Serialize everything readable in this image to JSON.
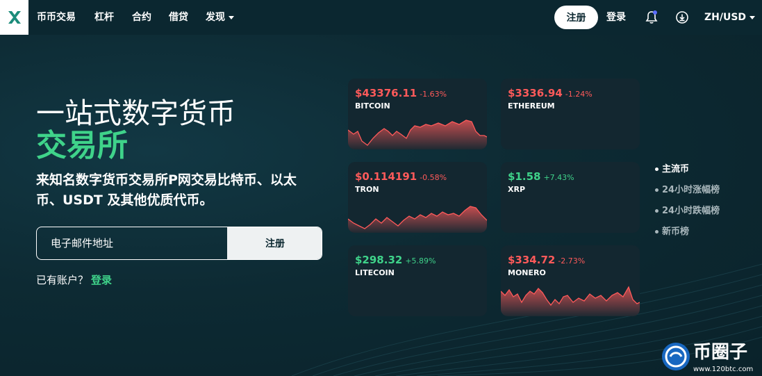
{
  "nav": {
    "items": [
      "币币交易",
      "杠杆",
      "合约",
      "借贷",
      "发现"
    ],
    "signup": "注册",
    "login": "登录",
    "locale": "ZH/USD"
  },
  "hero": {
    "line1": "一站式数字货币",
    "line2": "交易所",
    "subtitle": "来知名数字货币交易所P网交易比特币、以太币、USDT 及其他优质代币。",
    "email_placeholder": "电子邮件地址",
    "submit": "注册",
    "have_account": "已有账户？",
    "login_link": "登录"
  },
  "colors": {
    "accent": "#3fd38a",
    "negative": "#ff5a5a",
    "background": "#0d2a33"
  },
  "cards": [
    {
      "price": "$43376.11",
      "change": "-1.63%",
      "name": "BITCOIN",
      "trend": "down"
    },
    {
      "price": "$3336.94",
      "change": "-1.24%",
      "name": "ETHEREUM",
      "trend": "down"
    },
    {
      "price": "$0.114191",
      "change": "-0.58%",
      "name": "TRON",
      "trend": "down"
    },
    {
      "price": "$1.58",
      "change": "+7.43%",
      "name": "XRP",
      "trend": "up"
    },
    {
      "price": "$298.32",
      "change": "+5.89%",
      "name": "LITECOIN",
      "trend": "up"
    },
    {
      "price": "$334.72",
      "change": "-2.73%",
      "name": "MONERO",
      "trend": "down"
    }
  ],
  "side_tabs": [
    "主流币",
    "24小时涨幅榜",
    "24小时跌幅榜",
    "新币榜"
  ],
  "watermark": {
    "brand": "币圈子",
    "url": "www.120btc.com"
  }
}
